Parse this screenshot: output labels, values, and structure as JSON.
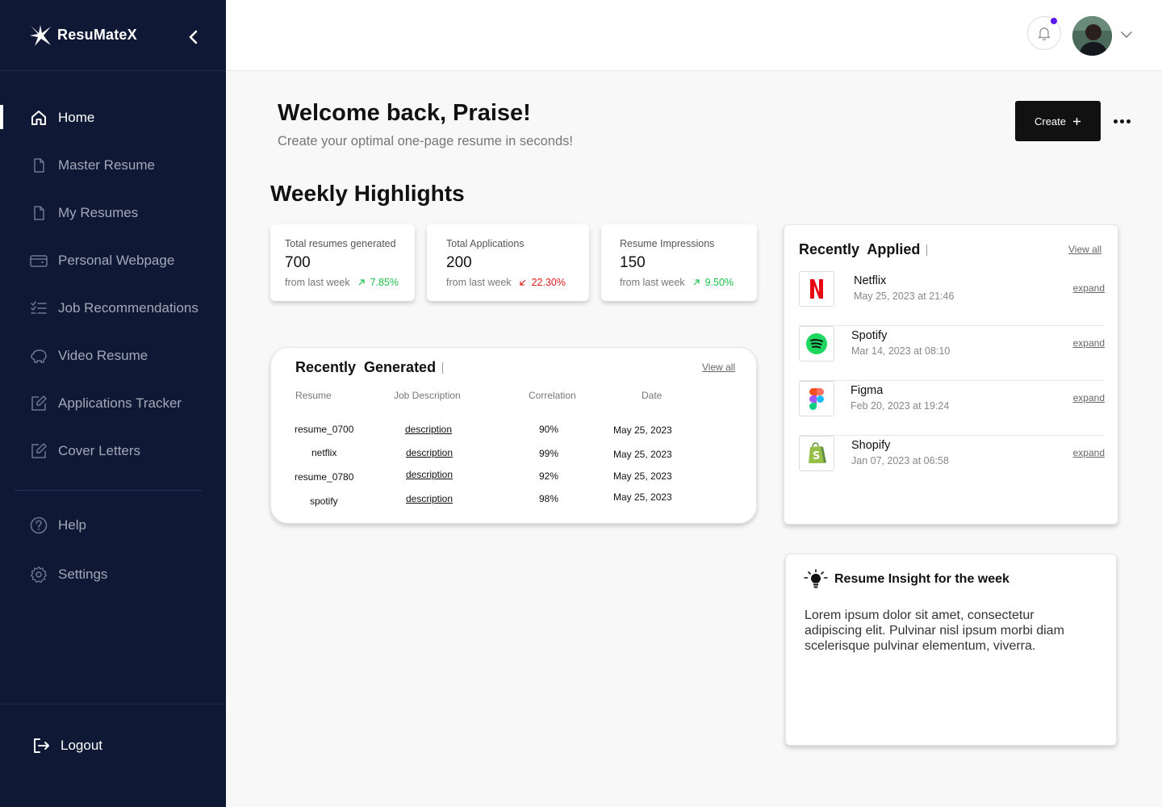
{
  "app": {
    "name": "ResuMateX"
  },
  "sidebar": {
    "items": [
      {
        "label": "Home",
        "icon": "home-icon"
      },
      {
        "label": "Master Resume",
        "icon": "file-icon"
      },
      {
        "label": "My Resumes",
        "icon": "file-icon"
      },
      {
        "label": "Personal Webpage",
        "icon": "card-icon"
      },
      {
        "label": "Job Recommendations",
        "icon": "checklist-icon"
      },
      {
        "label": "Video Resume",
        "icon": "piggy-icon"
      },
      {
        "label": "Applications Tracker",
        "icon": "edit-icon"
      },
      {
        "label": "Cover Letters",
        "icon": "edit-icon"
      }
    ],
    "secondary": [
      {
        "label": "Help",
        "icon": "help-icon"
      },
      {
        "label": "Settings",
        "icon": "gear-icon"
      }
    ],
    "logout": "Logout"
  },
  "header": {
    "welcome": "Welcome back, Praise!",
    "subtitle": "Create your optimal one-page resume in seconds!",
    "create_label": "Create"
  },
  "highlights": {
    "title": "Weekly Highlights",
    "stats": [
      {
        "label": "Total resumes generated",
        "value": "700",
        "foot": "from last week",
        "trend": "7.85%",
        "direction": "up"
      },
      {
        "label": "Total Applications",
        "value": "200",
        "foot": "from last week",
        "trend": "22.30%",
        "direction": "down"
      },
      {
        "label": "Resume Impressions",
        "value": "150",
        "foot": "from last week",
        "trend": "9.50%",
        "direction": "up"
      }
    ]
  },
  "generated": {
    "title": "Recently  Generated",
    "view_all": "View all",
    "columns": [
      "Resume",
      "Job Description",
      "Correlation",
      "Date"
    ],
    "rows": [
      {
        "resume": "resume_0700",
        "job": "description",
        "correlation": "90%",
        "date": "May 25, 2023"
      },
      {
        "resume": "netflix",
        "job": "description",
        "correlation": "99%",
        "date": "May 25, 2023"
      },
      {
        "resume": "resume_0780",
        "job": "description",
        "correlation": "92%",
        "date": "May 25, 2023"
      },
      {
        "resume": "spotify",
        "job": "description",
        "correlation": "98%",
        "date": "May 25, 2023"
      }
    ]
  },
  "applied": {
    "title": "Recently  Applied",
    "view_all": "View all",
    "rows": [
      {
        "name": "Netflix",
        "date": "May 25, 2023 at 21:46",
        "action": "expand",
        "icon": "netflix-icon"
      },
      {
        "name": "Spotify",
        "date": "Mar 14, 2023 at 08:10",
        "action": "expand",
        "icon": "spotify-icon"
      },
      {
        "name": "Figma",
        "date": "Feb 20, 2023 at 19:24",
        "action": "expand",
        "icon": "figma-icon"
      },
      {
        "name": "Shopify",
        "date": "Jan 07, 2023 at 06:58",
        "action": "expand",
        "icon": "shopify-icon"
      }
    ]
  },
  "insight": {
    "title": "Resume Insight for the week",
    "body": "Lorem ipsum dolor sit amet, consectetur adipiscing elit. Pulvinar nisl ipsum morbi diam scelerisque pulvinar elementum, viverra."
  },
  "colors": {
    "sidebar_bg": "#0f1834",
    "accent_dot": "#5b17f0",
    "trend_up": "#1dbf4a",
    "trend_down": "#e11a1a"
  }
}
